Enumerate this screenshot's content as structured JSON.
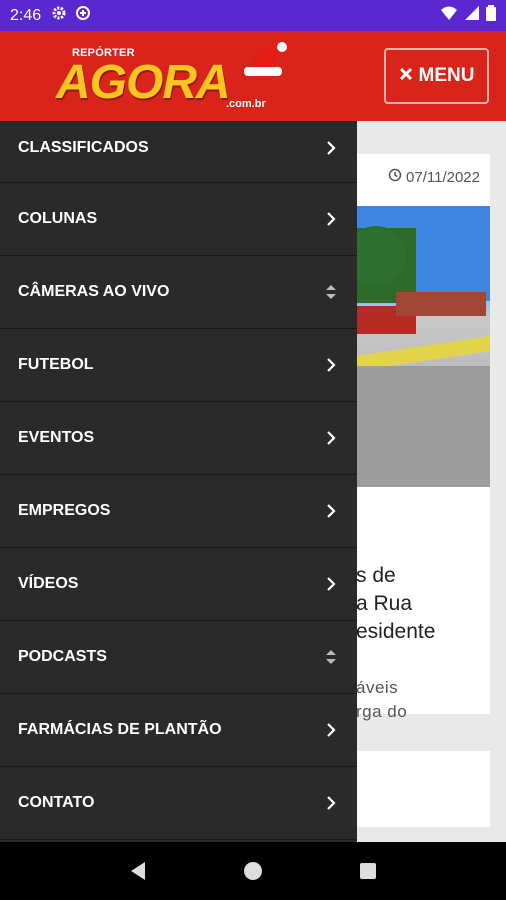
{
  "status_bar": {
    "time": "2:46"
  },
  "header": {
    "logo_small": "REPÓRTER",
    "logo_main": "AGORA",
    "logo_suffix": ".com.br",
    "menu_label": "MENU"
  },
  "article": {
    "date": "07/11/2022",
    "title_fragment": "s de\na Rua\nesidente",
    "excerpt_fragment": "áveis\nrga do"
  },
  "drawer": {
    "items": [
      {
        "label": "CLASSIFICADOS",
        "icon": "chevron-right-icon"
      },
      {
        "label": "COLUNAS",
        "icon": "chevron-right-icon"
      },
      {
        "label": "CÂMERAS AO VIVO",
        "icon": "sort-icon"
      },
      {
        "label": "FUTEBOL",
        "icon": "chevron-right-icon"
      },
      {
        "label": "EVENTOS",
        "icon": "chevron-right-icon"
      },
      {
        "label": "EMPREGOS",
        "icon": "chevron-right-icon"
      },
      {
        "label": "VÍDEOS",
        "icon": "chevron-right-icon"
      },
      {
        "label": "PODCASTS",
        "icon": "sort-icon"
      },
      {
        "label": "FARMÁCIAS DE PLANTÃO",
        "icon": "chevron-right-icon"
      },
      {
        "label": "CONTATO",
        "icon": "chevron-right-icon"
      }
    ]
  },
  "colors": {
    "status_bar": "#5b28cf",
    "header": "#d8241a",
    "drawer": "#2a2a2a",
    "logo": "#f8c623"
  }
}
